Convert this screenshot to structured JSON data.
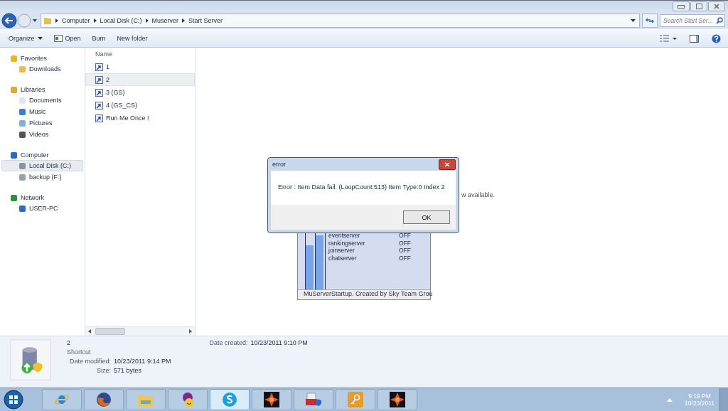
{
  "address_bar": {
    "crumbs": [
      "Computer",
      "Local Disk (C:)",
      "Muserver",
      "Start Server"
    ]
  },
  "search": {
    "placeholder": "Search Start Ser..."
  },
  "toolbar": {
    "items": [
      "Organize",
      "Open",
      "Burn",
      "New folder"
    ]
  },
  "nav_pane": {
    "groups": [
      {
        "label": "Favorites",
        "kind": "star",
        "children": [
          {
            "label": "Downloads",
            "kind": "folder",
            "selected": false
          }
        ]
      },
      {
        "label": "Libraries",
        "kind": "library",
        "children": [
          {
            "label": "Documents",
            "kind": "doc",
            "selected": false
          },
          {
            "label": "Music",
            "kind": "music",
            "selected": false
          },
          {
            "label": "Pictures",
            "kind": "picture",
            "selected": false
          },
          {
            "label": "Videos",
            "kind": "video",
            "selected": false
          }
        ]
      },
      {
        "label": "Computer",
        "kind": "computer",
        "children": [
          {
            "label": "Local Disk (C:)",
            "kind": "disk",
            "selected": true
          },
          {
            "label": "backup (F:)",
            "kind": "drive",
            "selected": false
          }
        ]
      },
      {
        "label": "Network",
        "kind": "network",
        "children": [
          {
            "label": "USER-PC",
            "kind": "computer",
            "selected": false
          }
        ]
      }
    ]
  },
  "file_list": {
    "column": "Name",
    "files": [
      {
        "name": "1",
        "selected": false
      },
      {
        "name": "2",
        "selected": true
      },
      {
        "name": "3 (GS)",
        "selected": false
      },
      {
        "name": "4 (GS_CS)",
        "selected": false
      },
      {
        "name": "Run Me Once !",
        "selected": false
      }
    ]
  },
  "preview_text": "w available.",
  "details": {
    "name": "2",
    "type": "Shortcut",
    "fields": [
      {
        "label": "Date modified:",
        "value": "10/23/2011 9:14 PM"
      },
      {
        "label": "Size:",
        "value": "571 bytes"
      }
    ],
    "created_label": "Date created:",
    "created_value": "10/23/2011 9:10 PM"
  },
  "server_window": {
    "meters": [
      {
        "level": 0.7
      },
      {
        "level": 0.85
      }
    ],
    "rows": [
      {
        "name": "eventserver",
        "state": "OFF"
      },
      {
        "name": "rankingserver",
        "state": "OFF"
      },
      {
        "name": "joinserver",
        "state": "OFF"
      },
      {
        "name": "chatserver",
        "state": "OFF"
      }
    ],
    "status": "MuServerStartup. Created by Sky Team Grou"
  },
  "dialog": {
    "title": "error",
    "message": "Error : Item Data fail. (LoopCount:513) Item Type:0 Index 2",
    "button": "OK"
  },
  "taskbar": {
    "items": [
      {
        "kind": "ie",
        "selected": false
      },
      {
        "kind": "firefox",
        "selected": false
      },
      {
        "kind": "explorer",
        "selected": false
      },
      {
        "kind": "messenger",
        "selected": false
      },
      {
        "kind": "skype",
        "selected": true
      },
      {
        "kind": "game",
        "selected": false
      },
      {
        "kind": "toolbox",
        "selected": false
      },
      {
        "kind": "key",
        "selected": false
      },
      {
        "kind": "game",
        "selected": false
      }
    ],
    "time": "9:19 PM",
    "date": "10/23/2011"
  }
}
